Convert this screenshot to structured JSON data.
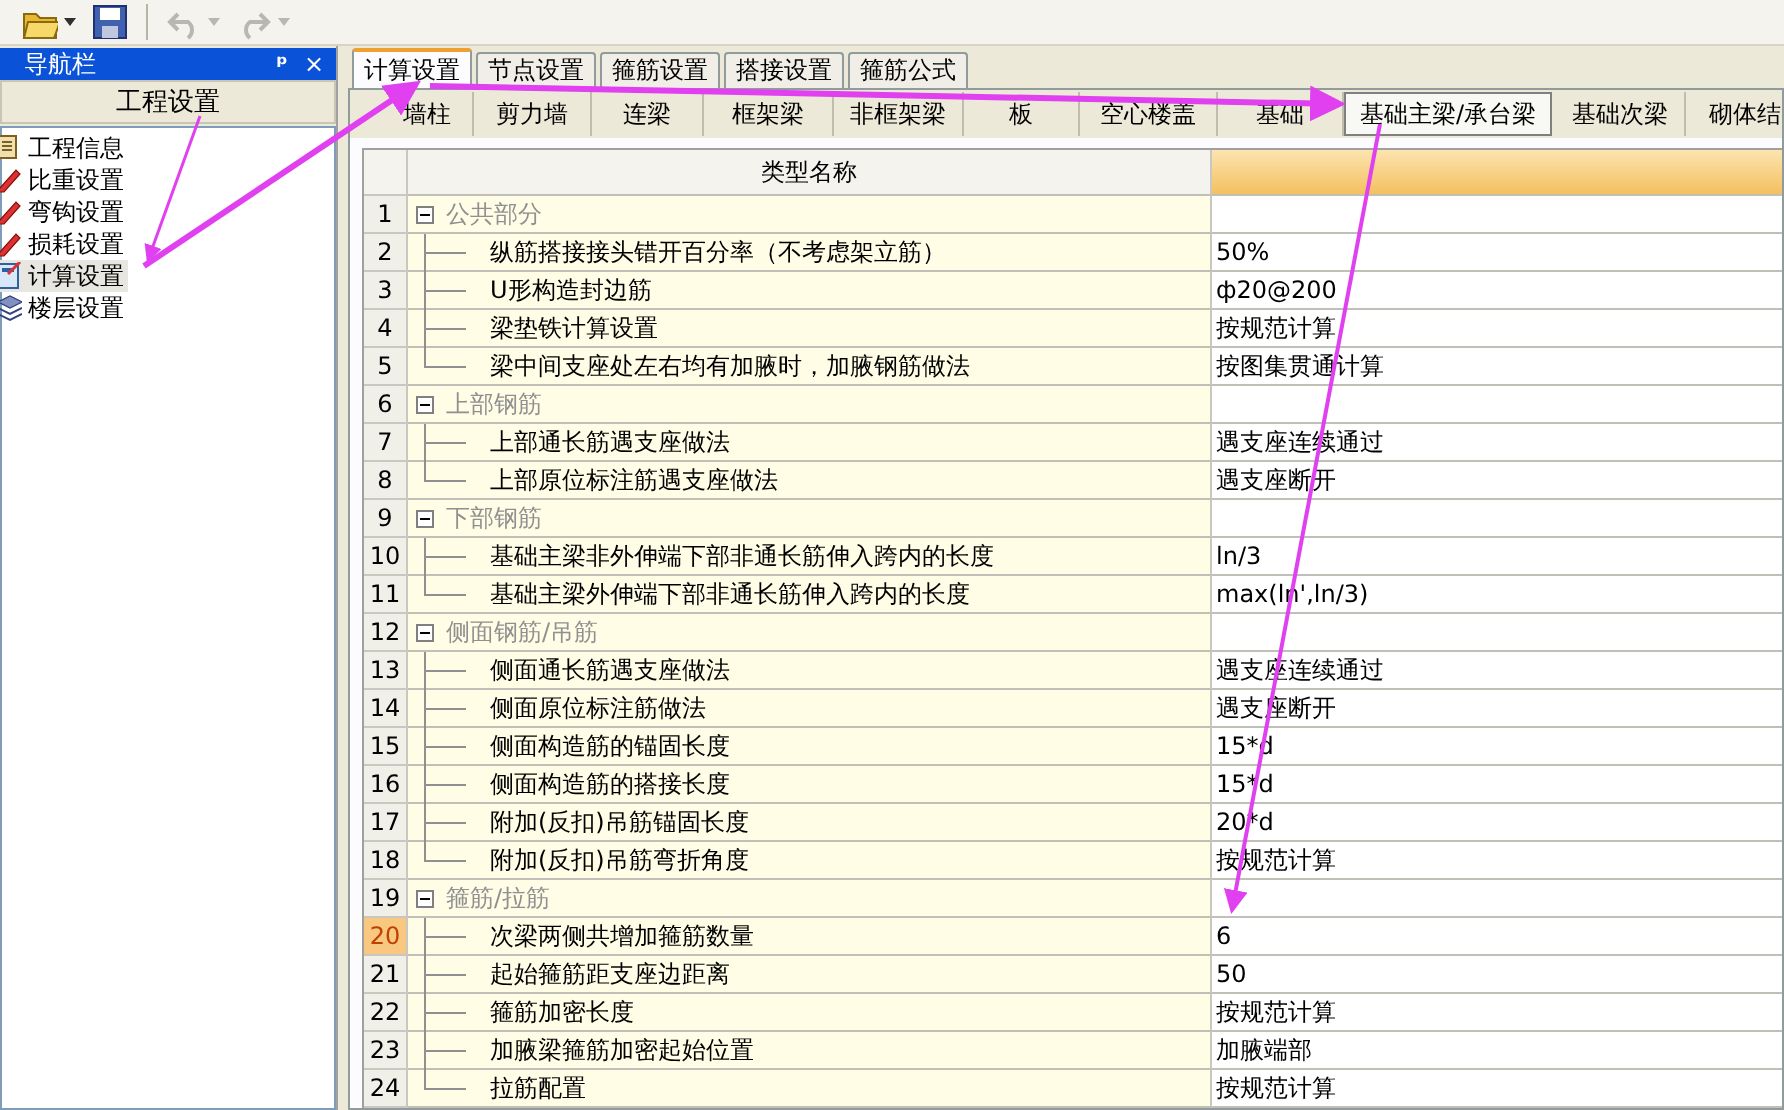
{
  "toolbar": [
    {
      "kind": "open",
      "disabled": false,
      "dropdown": true
    },
    {
      "kind": "save",
      "disabled": false,
      "dropdown": false
    },
    {
      "kind": "undo",
      "disabled": true,
      "dropdown": true
    },
    {
      "kind": "redo",
      "disabled": true,
      "dropdown": true
    }
  ],
  "nav_panel": {
    "title": "导航栏",
    "pin": "ᵖ",
    "close": "×",
    "section_button": "工程设置",
    "items": [
      {
        "label": "工程信息",
        "kind": "info",
        "selected": false
      },
      {
        "label": "比重设置",
        "kind": "edit",
        "selected": false
      },
      {
        "label": "弯钩设置",
        "kind": "edit",
        "selected": false
      },
      {
        "label": "损耗设置",
        "kind": "edit",
        "selected": false
      },
      {
        "label": "计算设置",
        "kind": "calc",
        "selected": true
      },
      {
        "label": "楼层设置",
        "kind": "floors",
        "selected": false
      }
    ]
  },
  "tabs": [
    {
      "label": "计算设置",
      "selected": true
    },
    {
      "label": "节点设置",
      "selected": false
    },
    {
      "label": "箍筋设置",
      "selected": false
    },
    {
      "label": "搭接设置",
      "selected": false
    },
    {
      "label": "箍筋公式",
      "selected": false
    }
  ],
  "subtabs": [
    {
      "label": "墙柱",
      "selected": false
    },
    {
      "label": "剪力墙",
      "selected": false
    },
    {
      "label": "连梁",
      "selected": false
    },
    {
      "label": "框架梁",
      "selected": false
    },
    {
      "label": "非框架梁",
      "selected": false
    },
    {
      "label": "板",
      "selected": false
    },
    {
      "label": "空心楼盖",
      "selected": false
    },
    {
      "label": "基础",
      "selected": false
    },
    {
      "label": "基础主梁/承台梁",
      "selected": true
    },
    {
      "label": "基础次梁",
      "selected": false
    },
    {
      "label": "砌体结",
      "selected": false
    }
  ],
  "table": {
    "columns": [
      "类型名称"
    ],
    "rows": [
      {
        "number": "1",
        "label": "公共部分",
        "expanded": true,
        "selected": false,
        "children": [
          {
            "number": "2",
            "label": "纵筋搭接接头错开百分率（不考虑架立筋）",
            "value": "50%",
            "selected": false
          },
          {
            "number": "3",
            "label": "U形构造封边筋",
            "value": "ф20@200",
            "selected": false
          },
          {
            "number": "4",
            "label": "梁垫铁计算设置",
            "value": "按规范计算",
            "selected": false
          },
          {
            "number": "5",
            "label": "梁中间支座处左右均有加腋时，加腋钢筋做法",
            "value": "按图集贯通计算",
            "selected": false
          }
        ]
      },
      {
        "number": "6",
        "label": "上部钢筋",
        "expanded": true,
        "selected": false,
        "children": [
          {
            "number": "7",
            "label": "上部通长筋遇支座做法",
            "value": "遇支座连续通过",
            "selected": false
          },
          {
            "number": "8",
            "label": "上部原位标注筋遇支座做法",
            "value": "遇支座断开",
            "selected": false
          }
        ]
      },
      {
        "number": "9",
        "label": "下部钢筋",
        "expanded": true,
        "selected": false,
        "children": [
          {
            "number": "10",
            "label": "基础主梁非外伸端下部非通长筋伸入跨内的长度",
            "value": "ln/3",
            "selected": false
          },
          {
            "number": "11",
            "label": "基础主梁外伸端下部非通长筋伸入跨内的长度",
            "value": "max(ln',ln/3)",
            "selected": false
          }
        ]
      },
      {
        "number": "12",
        "label": "侧面钢筋/吊筋",
        "expanded": true,
        "selected": false,
        "children": [
          {
            "number": "13",
            "label": "侧面通长筋遇支座做法",
            "value": "遇支座连续通过",
            "selected": false
          },
          {
            "number": "14",
            "label": "侧面原位标注筋做法",
            "value": "遇支座断开",
            "selected": false
          },
          {
            "number": "15",
            "label": "侧面构造筋的锚固长度",
            "value": "15*d",
            "selected": false
          },
          {
            "number": "16",
            "label": "侧面构造筋的搭接长度",
            "value": "15*d",
            "selected": false
          },
          {
            "number": "17",
            "label": "附加(反扣)吊筋锚固长度",
            "value": "20*d",
            "selected": false
          },
          {
            "number": "18",
            "label": "附加(反扣)吊筋弯折角度",
            "value": "按规范计算",
            "selected": false
          }
        ]
      },
      {
        "number": "19",
        "label": "箍筋/拉筋",
        "expanded": true,
        "selected": false,
        "children": [
          {
            "number": "20",
            "label": "次梁两侧共增加箍筋数量",
            "value": "6",
            "selected": true
          },
          {
            "number": "21",
            "label": "起始箍筋距支座边距离",
            "value": "50",
            "selected": false
          },
          {
            "number": "22",
            "label": "箍筋加密长度",
            "value": "按规范计算",
            "selected": false
          },
          {
            "number": "23",
            "label": "加腋梁箍筋加密起始位置",
            "value": "加腋端部",
            "selected": false
          },
          {
            "number": "24",
            "label": "拉筋配置",
            "value": "按规范计算",
            "selected": false
          }
        ]
      }
    ]
  }
}
